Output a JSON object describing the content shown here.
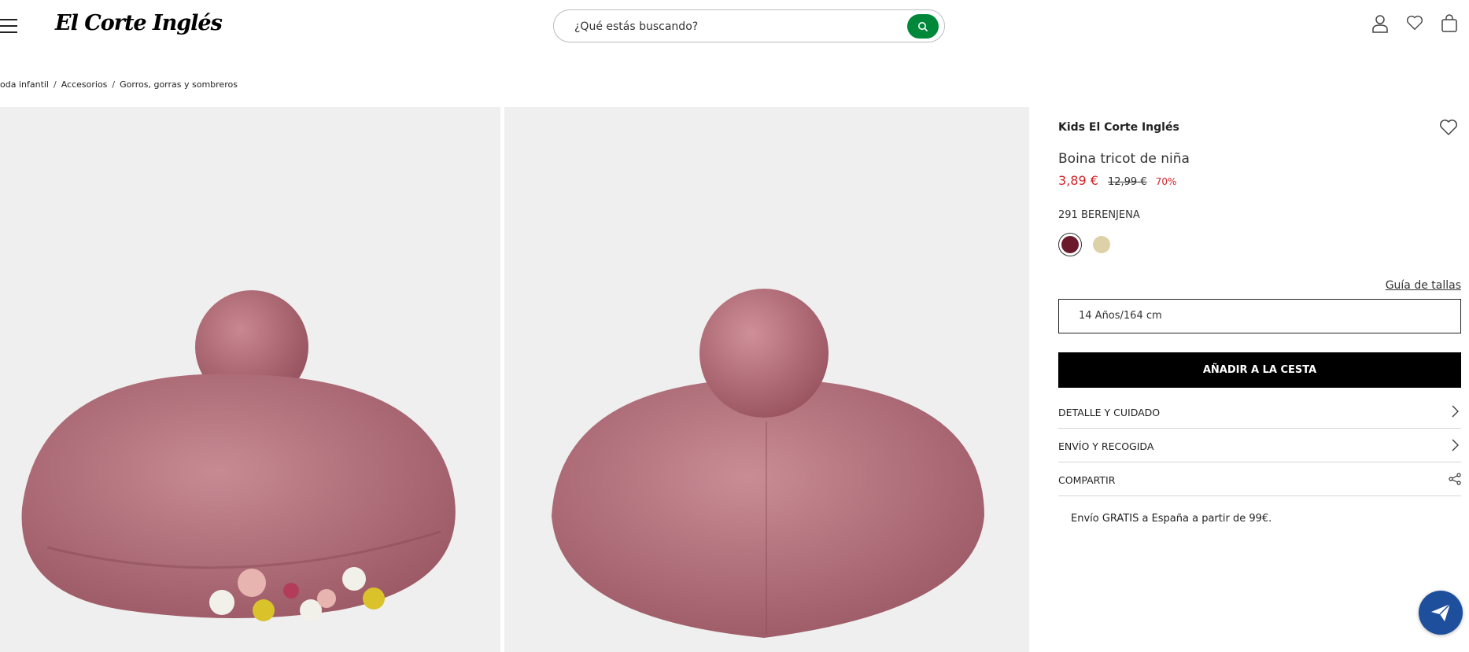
{
  "header": {
    "logo_text": "El Corte Inglés",
    "search_placeholder": "¿Qué estás buscando?",
    "icons": [
      "menu-icon",
      "search-icon",
      "user-icon",
      "heart-icon",
      "bag-icon"
    ]
  },
  "breadcrumb": [
    "oda infantil",
    "Accesorios",
    "Gorros, gorras y sombreros"
  ],
  "gallery": {
    "images": [
      "beret-with-flowers-image",
      "beret-side-view-image"
    ]
  },
  "product": {
    "brand": "Kids El Corte Inglés",
    "name": "Boina tricot de niña",
    "price": "3,89 €",
    "old_price": "12,99 €",
    "discount": "70%",
    "color_label": "291 BERENJENA",
    "colors": [
      "#6b1a2c",
      "#ddd1a8"
    ],
    "size_guide": "Guía de tallas",
    "size": "14 Años/164 cm",
    "add_to_cart": "AÑADIR A LA CESTA",
    "accordions": [
      "DETALLE Y CUIDADO",
      "ENVÍO Y RECOGIDA",
      "COMPARTIR"
    ],
    "shipping_note": "Envío GRATIS a España a partir de 99€."
  },
  "colors": {
    "accent_green": "#00883a",
    "sale_red": "#d2232a",
    "chat_blue": "#1e4f9c"
  }
}
